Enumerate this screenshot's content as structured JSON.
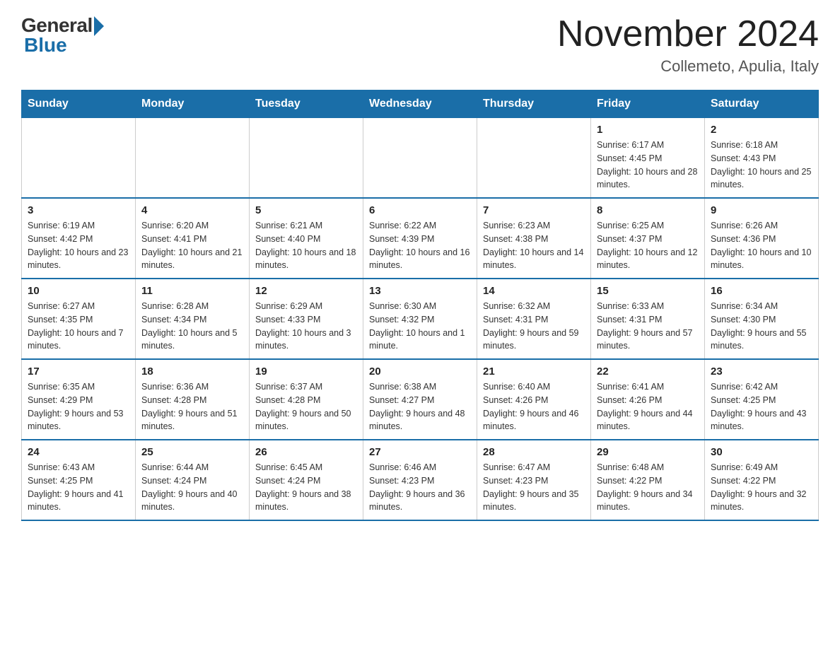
{
  "header": {
    "logo_general": "General",
    "logo_blue": "Blue",
    "month_year": "November 2024",
    "location": "Collemeto, Apulia, Italy"
  },
  "days_of_week": [
    "Sunday",
    "Monday",
    "Tuesday",
    "Wednesday",
    "Thursday",
    "Friday",
    "Saturday"
  ],
  "weeks": [
    [
      {
        "day": "",
        "info": ""
      },
      {
        "day": "",
        "info": ""
      },
      {
        "day": "",
        "info": ""
      },
      {
        "day": "",
        "info": ""
      },
      {
        "day": "",
        "info": ""
      },
      {
        "day": "1",
        "info": "Sunrise: 6:17 AM\nSunset: 4:45 PM\nDaylight: 10 hours and 28 minutes."
      },
      {
        "day": "2",
        "info": "Sunrise: 6:18 AM\nSunset: 4:43 PM\nDaylight: 10 hours and 25 minutes."
      }
    ],
    [
      {
        "day": "3",
        "info": "Sunrise: 6:19 AM\nSunset: 4:42 PM\nDaylight: 10 hours and 23 minutes."
      },
      {
        "day": "4",
        "info": "Sunrise: 6:20 AM\nSunset: 4:41 PM\nDaylight: 10 hours and 21 minutes."
      },
      {
        "day": "5",
        "info": "Sunrise: 6:21 AM\nSunset: 4:40 PM\nDaylight: 10 hours and 18 minutes."
      },
      {
        "day": "6",
        "info": "Sunrise: 6:22 AM\nSunset: 4:39 PM\nDaylight: 10 hours and 16 minutes."
      },
      {
        "day": "7",
        "info": "Sunrise: 6:23 AM\nSunset: 4:38 PM\nDaylight: 10 hours and 14 minutes."
      },
      {
        "day": "8",
        "info": "Sunrise: 6:25 AM\nSunset: 4:37 PM\nDaylight: 10 hours and 12 minutes."
      },
      {
        "day": "9",
        "info": "Sunrise: 6:26 AM\nSunset: 4:36 PM\nDaylight: 10 hours and 10 minutes."
      }
    ],
    [
      {
        "day": "10",
        "info": "Sunrise: 6:27 AM\nSunset: 4:35 PM\nDaylight: 10 hours and 7 minutes."
      },
      {
        "day": "11",
        "info": "Sunrise: 6:28 AM\nSunset: 4:34 PM\nDaylight: 10 hours and 5 minutes."
      },
      {
        "day": "12",
        "info": "Sunrise: 6:29 AM\nSunset: 4:33 PM\nDaylight: 10 hours and 3 minutes."
      },
      {
        "day": "13",
        "info": "Sunrise: 6:30 AM\nSunset: 4:32 PM\nDaylight: 10 hours and 1 minute."
      },
      {
        "day": "14",
        "info": "Sunrise: 6:32 AM\nSunset: 4:31 PM\nDaylight: 9 hours and 59 minutes."
      },
      {
        "day": "15",
        "info": "Sunrise: 6:33 AM\nSunset: 4:31 PM\nDaylight: 9 hours and 57 minutes."
      },
      {
        "day": "16",
        "info": "Sunrise: 6:34 AM\nSunset: 4:30 PM\nDaylight: 9 hours and 55 minutes."
      }
    ],
    [
      {
        "day": "17",
        "info": "Sunrise: 6:35 AM\nSunset: 4:29 PM\nDaylight: 9 hours and 53 minutes."
      },
      {
        "day": "18",
        "info": "Sunrise: 6:36 AM\nSunset: 4:28 PM\nDaylight: 9 hours and 51 minutes."
      },
      {
        "day": "19",
        "info": "Sunrise: 6:37 AM\nSunset: 4:28 PM\nDaylight: 9 hours and 50 minutes."
      },
      {
        "day": "20",
        "info": "Sunrise: 6:38 AM\nSunset: 4:27 PM\nDaylight: 9 hours and 48 minutes."
      },
      {
        "day": "21",
        "info": "Sunrise: 6:40 AM\nSunset: 4:26 PM\nDaylight: 9 hours and 46 minutes."
      },
      {
        "day": "22",
        "info": "Sunrise: 6:41 AM\nSunset: 4:26 PM\nDaylight: 9 hours and 44 minutes."
      },
      {
        "day": "23",
        "info": "Sunrise: 6:42 AM\nSunset: 4:25 PM\nDaylight: 9 hours and 43 minutes."
      }
    ],
    [
      {
        "day": "24",
        "info": "Sunrise: 6:43 AM\nSunset: 4:25 PM\nDaylight: 9 hours and 41 minutes."
      },
      {
        "day": "25",
        "info": "Sunrise: 6:44 AM\nSunset: 4:24 PM\nDaylight: 9 hours and 40 minutes."
      },
      {
        "day": "26",
        "info": "Sunrise: 6:45 AM\nSunset: 4:24 PM\nDaylight: 9 hours and 38 minutes."
      },
      {
        "day": "27",
        "info": "Sunrise: 6:46 AM\nSunset: 4:23 PM\nDaylight: 9 hours and 36 minutes."
      },
      {
        "day": "28",
        "info": "Sunrise: 6:47 AM\nSunset: 4:23 PM\nDaylight: 9 hours and 35 minutes."
      },
      {
        "day": "29",
        "info": "Sunrise: 6:48 AM\nSunset: 4:22 PM\nDaylight: 9 hours and 34 minutes."
      },
      {
        "day": "30",
        "info": "Sunrise: 6:49 AM\nSunset: 4:22 PM\nDaylight: 9 hours and 32 minutes."
      }
    ]
  ]
}
